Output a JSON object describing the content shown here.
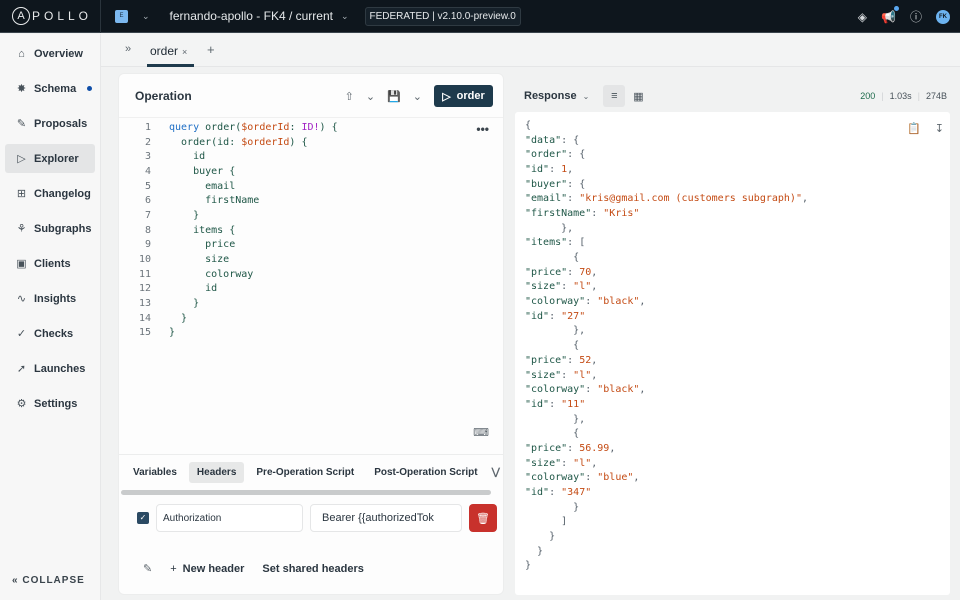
{
  "topbar": {
    "logo": "APOLLO",
    "org_badge": "E",
    "graph_ref": "fernando-apollo - FK4 / current",
    "federation_badge": "FEDERATED | v2.10.0-preview.0",
    "avatar_initials": "FK"
  },
  "sidebar": {
    "items": [
      {
        "label": "Overview",
        "icon": "overview-icon"
      },
      {
        "label": "Schema",
        "icon": "schema-icon",
        "has_dot": true
      },
      {
        "label": "Proposals",
        "icon": "proposals-icon"
      },
      {
        "label": "Explorer",
        "icon": "explorer-icon",
        "active": true
      },
      {
        "label": "Changelog",
        "icon": "changelog-icon"
      },
      {
        "label": "Subgraphs",
        "icon": "subgraphs-icon"
      },
      {
        "label": "Clients",
        "icon": "clients-icon"
      },
      {
        "label": "Insights",
        "icon": "insights-icon"
      },
      {
        "label": "Checks",
        "icon": "checks-icon"
      },
      {
        "label": "Launches",
        "icon": "launches-icon"
      },
      {
        "label": "Settings",
        "icon": "settings-icon"
      }
    ],
    "collapse_label": "COLLAPSE"
  },
  "tabs": {
    "items": [
      {
        "label": "order",
        "active": true
      }
    ]
  },
  "operation": {
    "title": "Operation",
    "run_label": "order",
    "code_lines": [
      "query order($orderId: ID!) {",
      "  order(id: $orderId) {",
      "    id",
      "    buyer {",
      "      email",
      "      firstName",
      "    }",
      "    items {",
      "      price",
      "      size",
      "      colorway",
      "      id",
      "    }",
      "  }",
      "}"
    ],
    "bottom_tabs": [
      "Variables",
      "Headers",
      "Pre-Operation Script",
      "Post-Operation Script"
    ],
    "active_bottom_tab": "Headers",
    "header_row": {
      "enabled": true,
      "key": "Authorization",
      "value": "Bearer {{authorizedTok"
    },
    "new_header_label": "New header",
    "shared_headers_label": "Set shared headers"
  },
  "response": {
    "title": "Response",
    "status": "200",
    "time": "1.03s",
    "size": "274B",
    "json_lines": [
      "{",
      "  \"data\": {",
      "    \"order\": {",
      "      \"id\": 1,",
      "      \"buyer\": {",
      "        \"email\": \"kris@gmail.com (customers subgraph)\",",
      "        \"firstName\": \"Kris\"",
      "      },",
      "      \"items\": [",
      "        {",
      "          \"price\": 70,",
      "          \"size\": \"l\",",
      "          \"colorway\": \"black\",",
      "          \"id\": \"27\"",
      "        },",
      "        {",
      "          \"price\": 52,",
      "          \"size\": \"l\",",
      "          \"colorway\": \"black\",",
      "          \"id\": \"11\"",
      "        },",
      "        {",
      "          \"price\": 56.99,",
      "          \"size\": \"l\",",
      "          \"colorway\": \"blue\",",
      "          \"id\": \"347\"",
      "        }",
      "      ]",
      "    }",
      "  }",
      "}"
    ]
  }
}
